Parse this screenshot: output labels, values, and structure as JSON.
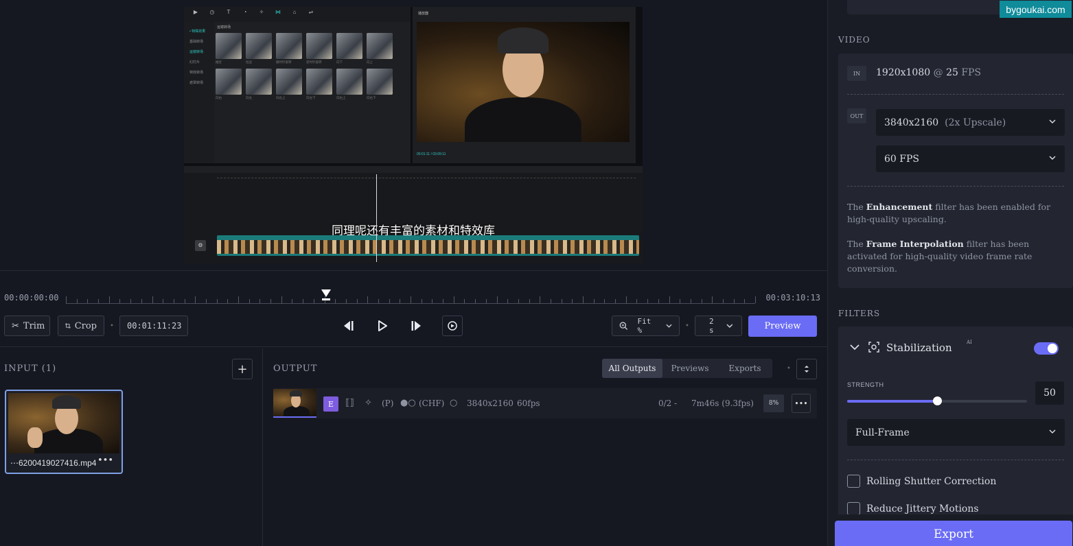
{
  "watermark": "bygoukai.com",
  "preview": {
    "subtitle": "同理呢还有丰富的素材和特效库",
    "capcut_tools": [
      "▶",
      "◷",
      "T",
      "◔",
      "✧",
      "⋈",
      "⌂",
      "⇌"
    ],
    "capcut_side_items": [
      "• 特殊效果",
      "基础转场",
      "运镜转场",
      "幻灯片",
      "特效转场",
      "遮罩转场"
    ],
    "capcut_grid_title": "运镜转场",
    "capcut_grid_captions": [
      "推近",
      "拉远",
      "顺时针旋转",
      "逆时针旋转",
      "向下",
      "向上",
      "向右",
      "向左",
      "向右上",
      "向左下",
      "向右上",
      "向右下"
    ],
    "capcut_player_title": "播放器",
    "capcut_player_time": "00:01:11 / 03:09:11"
  },
  "timeline": {
    "start_time": "00:00:00:00",
    "end_time": "00:03:10:13"
  },
  "controls": {
    "trim_label": "Trim",
    "crop_label": "Crop",
    "timecode": "00:01:11:23",
    "fit_label": "Fit %",
    "speed_label": "2 s",
    "preview_label": "Preview"
  },
  "input": {
    "title": "INPUT (1)",
    "filename": "⋯6200419027416.mp4",
    "menu_glyph": "•••"
  },
  "output": {
    "title": "OUTPUT",
    "tabs": [
      "All Outputs",
      "Previews",
      "Exports"
    ],
    "row": {
      "badge": "E",
      "p_label": "(P)",
      "chf_label": "(CHF)",
      "resolution": "3840x2160",
      "fps": "60fps",
      "progress": "0/2 -",
      "eta": "7m46s (9.3fps)",
      "percent": "8%",
      "menu_glyph": "•••"
    }
  },
  "right_panel": {
    "video_title": "VIDEO",
    "in_tag": "IN",
    "in_resolution": "1920x1080",
    "in_at": "@",
    "in_fps": "25",
    "in_fps_unit": "FPS",
    "out_tag": "OUT",
    "out_resolution": "3840x2160",
    "out_upscale": "(2x Upscale)",
    "out_fps": "60 FPS",
    "enh_prefix": "The ",
    "enh_name": "Enhancement",
    "enh_suffix": " filter has been enabled for high-quality upscaling.",
    "fi_prefix": "The ",
    "fi_name": "Frame Interpolation",
    "fi_suffix": " filter has been activated for high-quality video frame rate conversion.",
    "filters_title": "FILTERS",
    "stab_title": "Stabilization",
    "stab_ai": "AI",
    "stab_enabled": true,
    "strength_label": "STRENGTH",
    "strength_value": "50",
    "strength_fraction": 0.5,
    "mode": "Full-Frame",
    "rolling_shutter": "Rolling Shutter Correction",
    "reduce_jitter": "Reduce Jittery Motions",
    "export_label": "Export"
  },
  "colors": {
    "accent": "#6a6cf5",
    "badge": "#7e5ce0",
    "watermark": "#0f8b9a"
  }
}
